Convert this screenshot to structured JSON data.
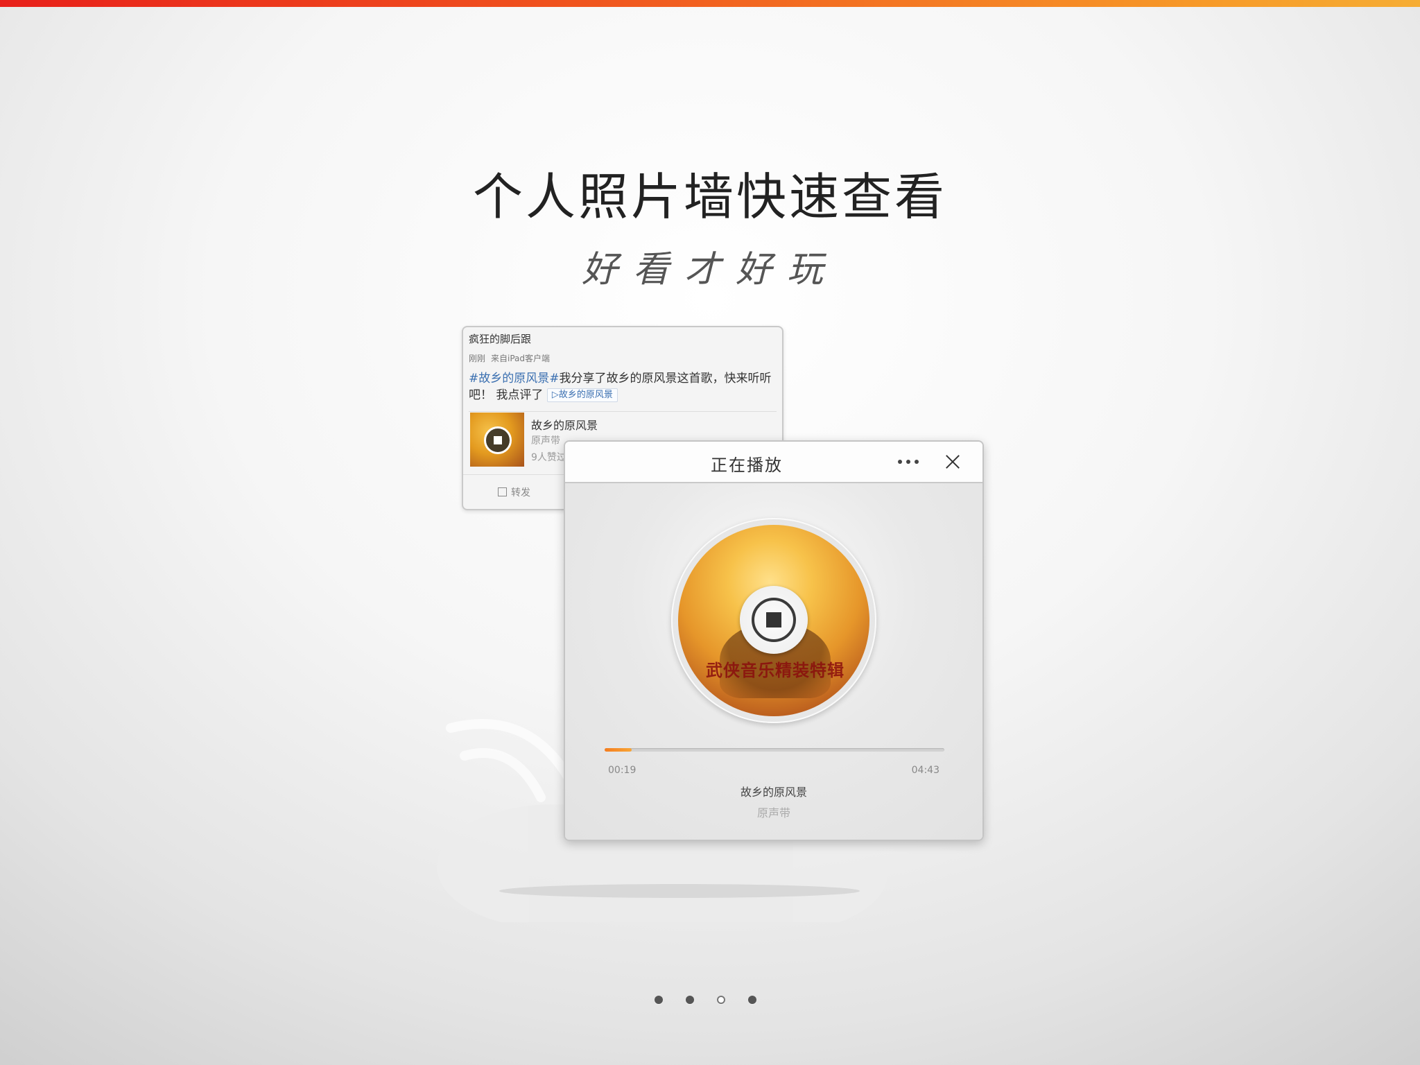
{
  "header": {
    "headline": "个人照片墙快速查看",
    "tagline": "好看才好玩"
  },
  "weibo_card": {
    "username": "疯狂的脚后跟",
    "time": "刚刚",
    "source": "来自iPad客户端",
    "topic": "#故乡的原风景#",
    "text": "我分享了故乡的原风景这首歌，快来听听吧！ 我点评了",
    "song_tag": "故乡的原风景",
    "song_title": "故乡的原风景",
    "album": "原声带",
    "likes": "9人赞过",
    "forward_label": "转发"
  },
  "player": {
    "title": "正在播放",
    "disc_text": "武侠音乐精装特辑",
    "current_time": "00:19",
    "total_time": "04:43",
    "progress": 0.08,
    "song_title": "故乡的原风景",
    "album": "原声带"
  },
  "pager": {
    "count": 4,
    "active_index": 2
  },
  "colors": {
    "top_bar_start": "#e8201a",
    "top_bar_end": "#f6ad34",
    "topic_link": "#3a6fb0",
    "progress": "#f47d1f"
  },
  "icons": [
    "stop-icon",
    "more-icon",
    "close-icon",
    "forward-icon"
  ]
}
